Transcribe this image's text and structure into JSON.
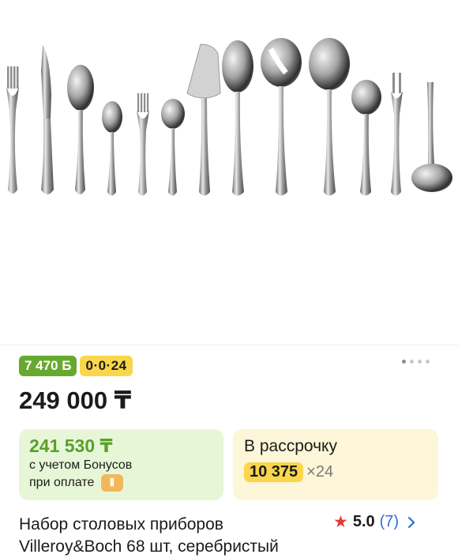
{
  "product_gallery": {
    "image_description_icon": "cutlery-set-icon",
    "pager": {
      "total": 4,
      "active": 1
    }
  },
  "badges": {
    "bonus": "7 470 Б",
    "installment": "0·0·24"
  },
  "price": "249 000 ₸",
  "bonus_card": {
    "price": "241 530 ₸",
    "line1": "с учетом Бонусов",
    "line2": "при оплате",
    "icon": "payment-logo-icon"
  },
  "installment_card": {
    "title": "В рассрочку",
    "monthly": "10 375",
    "months": "×24"
  },
  "product_title": "Набор столовых приборов Villeroy&Boch 68 шт, серебристый",
  "rating": {
    "value": "5.0",
    "count": "(7)",
    "icon": "star-icon",
    "chevron": "chevron-right-icon"
  },
  "colors": {
    "bonus_green": "#67a92f",
    "installment_yellow": "#f9d64b",
    "link_blue": "#2f6fd6",
    "star_red": "#e53935"
  }
}
